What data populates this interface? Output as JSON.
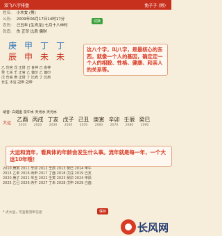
{
  "header": {
    "title": "双飞八字排盘",
    "right": "兔子子 (男)"
  },
  "info": {
    "name_label": "姓名:",
    "name_value": "小木女 (男)",
    "gongli_label": "公历:",
    "gongli_value": "2009年06月17日14时17分",
    "nongli_label": "农历:",
    "nongli_value": "己丑年 [生肖龙] 七月十八申时",
    "qianzao_label": "乾造:",
    "qianzao_value": "伤 正印 比肩 偏财",
    "switch_button": "切换"
  },
  "pillars": [
    {
      "stem": "庚",
      "branch": "辰"
    },
    {
      "stem": "甲",
      "branch": "申"
    },
    {
      "stem": "丁",
      "branch": "未"
    },
    {
      "stem": "丁",
      "branch": "未"
    }
  ],
  "gods_lines": [
    "乙 伤官   戊 正财   己 食神   己 食神",
    "癸 七杀   壬 正官   乙 偏印   乙 偏印",
    "戊 伤官   庚 正财   丁 比肩   丁 比肩",
    "长生   沐浴   冠带   冠带"
  ],
  "callout1": "这八个字，叫八字，是最核心的东西，就像一个人的基因，确定定一个人的相貌、性格、健康、和亲人的关系等。",
  "naying": "纳音: 白蜡金  泉中水  天河水  天河水",
  "dayun": {
    "label": "大运",
    "items": [
      {
        "gz": "乙酉",
        "yr": "2010"
      },
      {
        "gz": "丙戌",
        "yr": "2020"
      },
      {
        "gz": "丁亥",
        "yr": "2030"
      },
      {
        "gz": "戊子",
        "yr": "2040"
      },
      {
        "gz": "己丑",
        "yr": "2050"
      },
      {
        "gz": "庚寅",
        "yr": "2060"
      },
      {
        "gz": "辛卯",
        "yr": "2070"
      },
      {
        "gz": "壬辰",
        "yr": "2080"
      },
      {
        "gz": "癸巳",
        "yr": "2090"
      }
    ]
  },
  "callout2": "大运和流年，看具体的年龄会发生什么事。流年就是每一年，一个大运10年哦！",
  "liunian_lines": [
    "2010 庚寅  2011 辛卯  2012 壬辰  2013 癸巳  2014 甲午",
    "2015 乙未  2016 丙申  2017 丁酉  2018 戊戌  2019 己亥",
    "2020 庚子  2021 辛丑  2022 壬寅  2023 癸卯  2024 甲辰",
    "2025 乙巳  2026 丙午  2027 丁未  2028 戊申  2029 己酉"
  ],
  "bottom_note": "* 点大运，可查看流年信息",
  "bottom_button": "保存",
  "watermark": "长风网"
}
